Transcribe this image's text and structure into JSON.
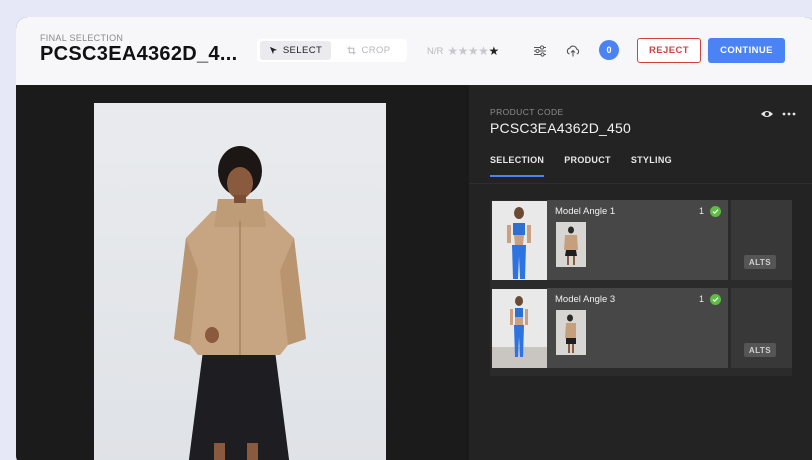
{
  "header": {
    "subtitle": "FINAL SELECTION",
    "title": "PCSC3EA4362D_4...",
    "tools": {
      "select_label": "SELECT",
      "crop_label": "CROP",
      "active": "select"
    },
    "rating": {
      "label": "N/R",
      "stars_total": 5,
      "stars_filled": 1
    },
    "badge_count": "0",
    "reject_label": "REJECT",
    "continue_label": "CONTINUE",
    "icons": [
      "sliders-icon",
      "upload-icon"
    ]
  },
  "panel": {
    "product_code_label": "PRODUCT CODE",
    "product_code": "PCSC3EA4362D_450",
    "tabs": [
      {
        "label": "SELECTION",
        "active": true
      },
      {
        "label": "PRODUCT",
        "active": false
      },
      {
        "label": "STYLING",
        "active": false
      }
    ],
    "angles": [
      {
        "name": "Model Angle 1",
        "count": "1",
        "alts_label": "ALTS"
      },
      {
        "name": "Model Angle 3",
        "count": "1",
        "alts_label": "ALTS"
      }
    ]
  },
  "colors": {
    "accent": "#4b83f4",
    "reject": "#d64040",
    "success": "#5dbb46",
    "panel": "#232323",
    "canvas": "#1b1b1b"
  }
}
